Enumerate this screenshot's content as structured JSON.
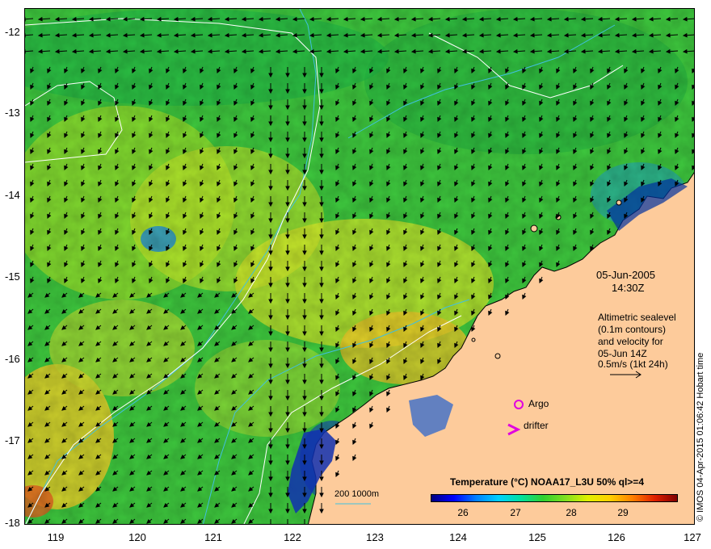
{
  "header": {
    "date": "05-Jun-2005",
    "time": "14:30Z"
  },
  "legend": {
    "line1": "Altimetric sealevel",
    "line2": "(0.1m contours)",
    "line3": "and velocity for",
    "line4": "05-Jun 14Z",
    "scale_label": "0.5m/s (1kt 24h)"
  },
  "markers": {
    "argo_label": "Argo",
    "drifter_label": "drifter",
    "marker_color": "#e000e0"
  },
  "depth_legend": {
    "label": "200  1000m",
    "color": "#40c0e0"
  },
  "colorbar": {
    "title": "Temperature (°C) NOAA17_L3U 50% ql>=4",
    "ticks": [
      "26",
      "27",
      "28",
      "29"
    ]
  },
  "credit": "© IMOS 04-Apr-2015 01:06:42 Hobart time",
  "axes": {
    "x_ticks": [
      "119",
      "120",
      "121",
      "122",
      "123",
      "124",
      "125",
      "126",
      "127"
    ],
    "y_ticks": [
      "-12",
      "-13",
      "-14",
      "-15",
      "-16",
      "-17",
      "-18"
    ]
  },
  "colors": {
    "land": "#fdcb9b",
    "sea_base": "#38c838",
    "contour": "#ffffff",
    "isobath": "#40c0e0"
  }
}
